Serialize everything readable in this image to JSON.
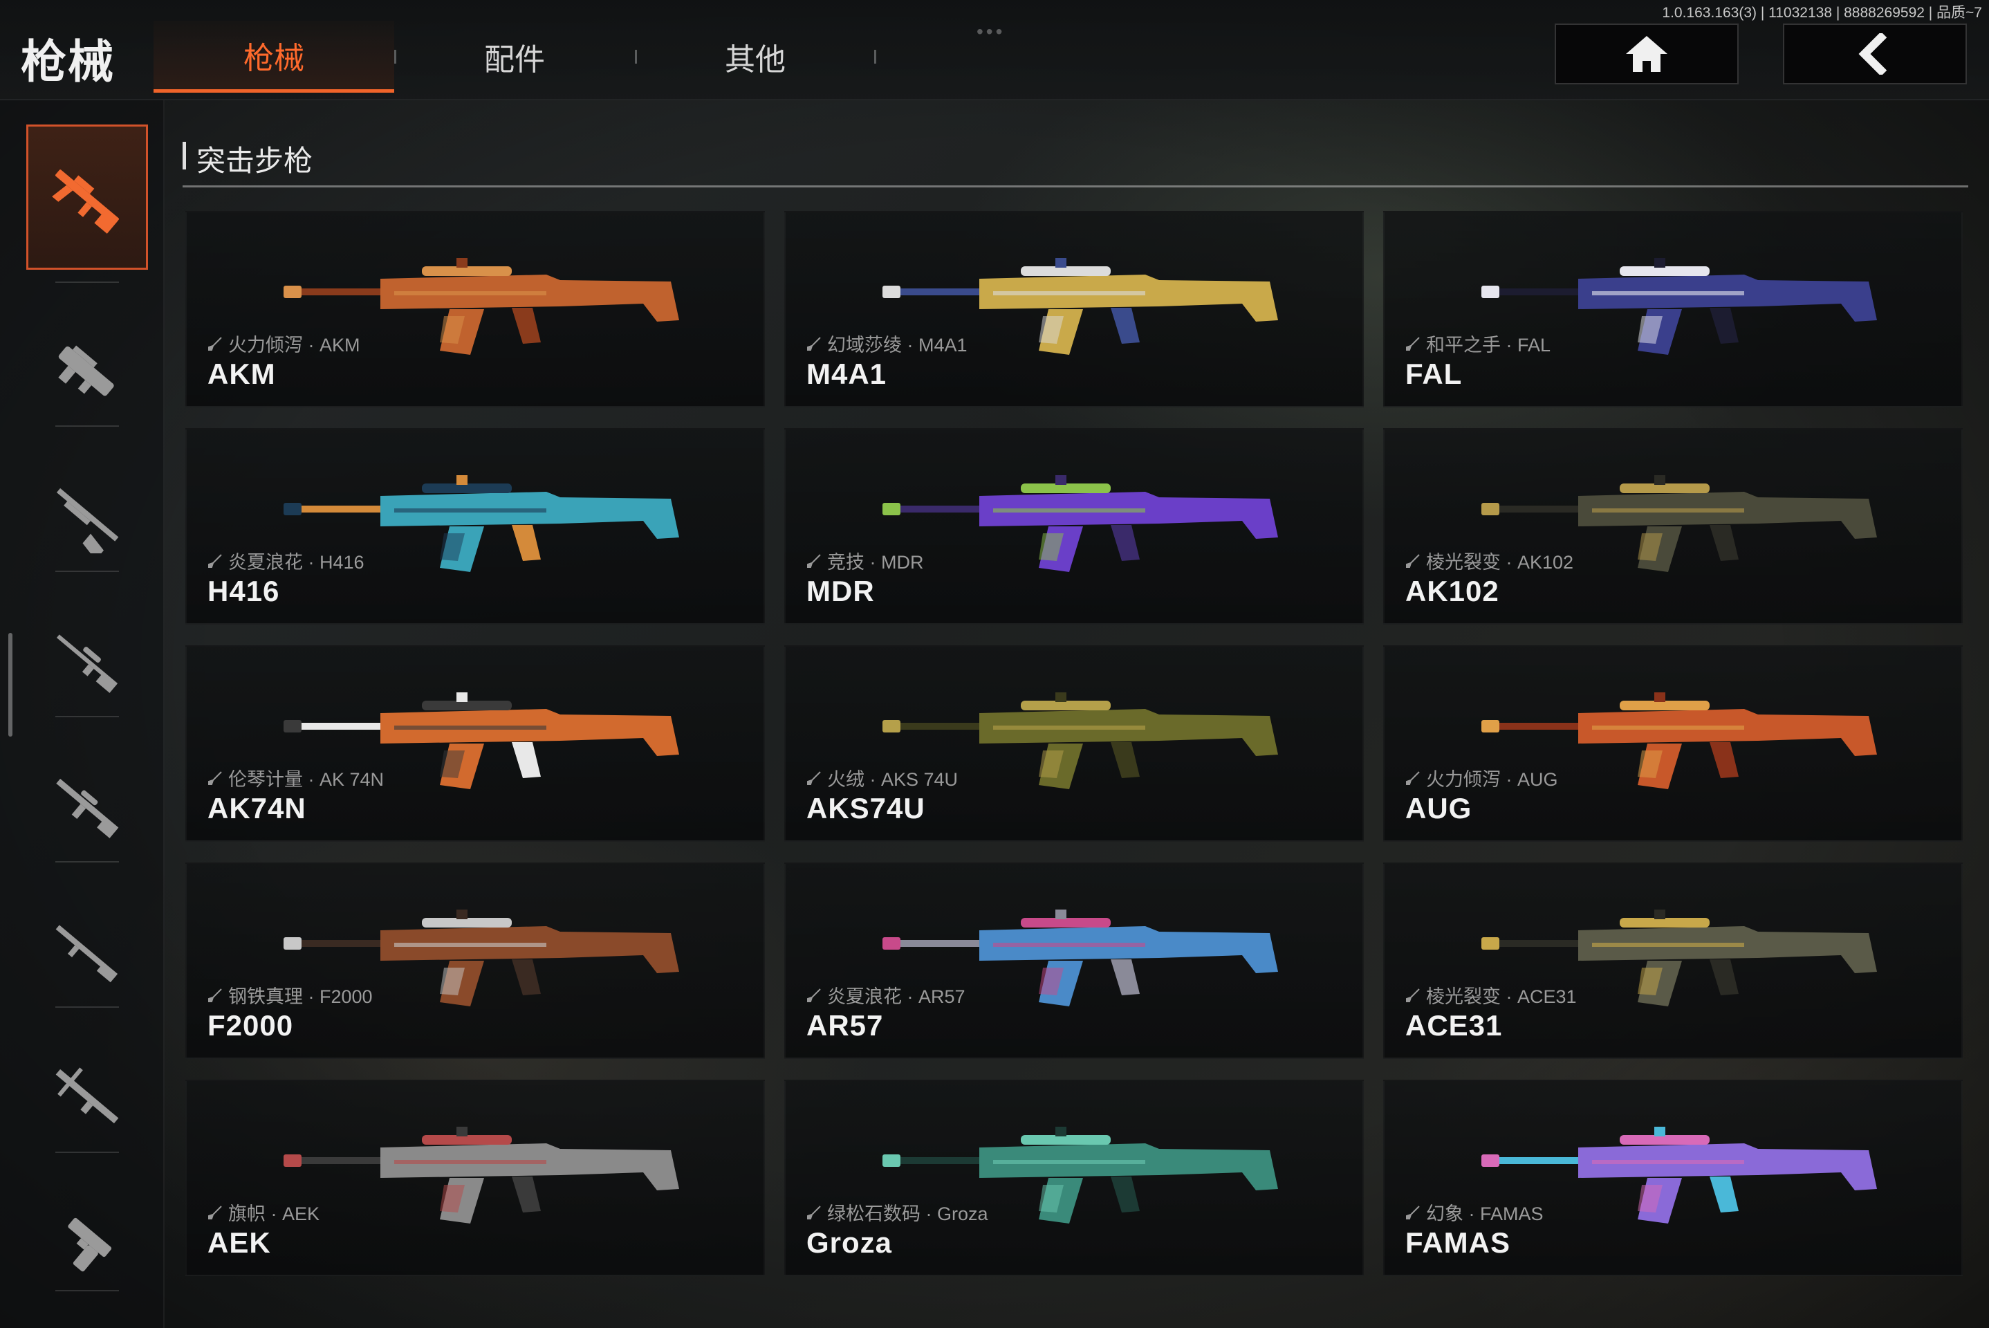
{
  "header": {
    "title": "枪械",
    "tabs": [
      {
        "label": "枪械",
        "active": true
      },
      {
        "label": "配件",
        "active": false
      },
      {
        "label": "其他",
        "active": false
      }
    ],
    "version_text": "1.0.163.163(3) | 11032138 | 8888269592 | 品质~7",
    "home_icon": "home-icon",
    "back_icon": "back-arrow-icon"
  },
  "sidebar": {
    "categories": [
      {
        "icon": "assault-rifle-icon",
        "active": true
      },
      {
        "icon": "smg-icon",
        "active": false
      },
      {
        "icon": "shotgun-icon",
        "active": false
      },
      {
        "icon": "sniper-rifle-icon",
        "active": false
      },
      {
        "icon": "marksman-rifle-icon",
        "active": false
      },
      {
        "icon": "lmg-icon",
        "active": false
      },
      {
        "icon": "crossbow-icon",
        "active": false
      },
      {
        "icon": "pistol-icon",
        "active": false
      }
    ]
  },
  "section": {
    "title": "突击步枪"
  },
  "colors": {
    "accent": "#f0642a",
    "active_text": "#ff6a2c"
  },
  "weapons": [
    {
      "name": "AKM",
      "skin": "火力倾泻 · AKM",
      "palette": [
        "#c0622e",
        "#d9914a",
        "#8a3b1c"
      ]
    },
    {
      "name": "M4A1",
      "skin": "幻域莎绫 · M4A1",
      "palette": [
        "#c9a94a",
        "#dcdcdc",
        "#3a4b8c"
      ]
    },
    {
      "name": "FAL",
      "skin": "和平之手 · FAL",
      "palette": [
        "#3a3f8c",
        "#e6e6ee",
        "#1c1c30"
      ]
    },
    {
      "name": "H416",
      "skin": "炎夏浪花 · H416",
      "palette": [
        "#3aa3b8",
        "#1c3b55",
        "#d48a3a"
      ]
    },
    {
      "name": "MDR",
      "skin": "竞技 · MDR",
      "palette": [
        "#6a3fc8",
        "#8bc24a",
        "#3a2a6a"
      ]
    },
    {
      "name": "AK102",
      "skin": "棱光裂变 · AK102",
      "palette": [
        "#4a4a3a",
        "#b59a4a",
        "#2a2a24"
      ]
    },
    {
      "name": "AK74N",
      "skin": "伦琴计量 · AK 74N",
      "palette": [
        "#d26a2e",
        "#3a3a3a",
        "#e8e8e8"
      ]
    },
    {
      "name": "AKS74U",
      "skin": "火绒 · AKS 74U",
      "palette": [
        "#6a6a2a",
        "#b5a04a",
        "#3a3a1c"
      ]
    },
    {
      "name": "AUG",
      "skin": "火力倾泻 · AUG",
      "palette": [
        "#c8582a",
        "#e0a048",
        "#8a321a"
      ]
    },
    {
      "name": "F2000",
      "skin": "钢铁真理 · F2000",
      "palette": [
        "#8a4a2a",
        "#c8c8c8",
        "#3a2a22"
      ]
    },
    {
      "name": "AR57",
      "skin": "炎夏浪花 · AR57",
      "palette": [
        "#4a8ac8",
        "#c84a8a",
        "#8a8a98"
      ]
    },
    {
      "name": "ACE31",
      "skin": "棱光裂变 · ACE31",
      "palette": [
        "#5a5a48",
        "#c8a84a",
        "#2a2a24"
      ]
    },
    {
      "name": "AEK",
      "skin": "旗帜 · AEK",
      "palette": [
        "#8a8a8a",
        "#b54a4a",
        "#3a3a3a"
      ]
    },
    {
      "name": "Groza",
      "skin": "绿松石数码 · Groza",
      "palette": [
        "#3a8a7a",
        "#6ac8b0",
        "#1c3a34"
      ]
    },
    {
      "name": "FAMAS",
      "skin": "幻象 · FAMAS",
      "palette": [
        "#8a6ad8",
        "#d86ab8",
        "#4ab8d8"
      ]
    }
  ]
}
